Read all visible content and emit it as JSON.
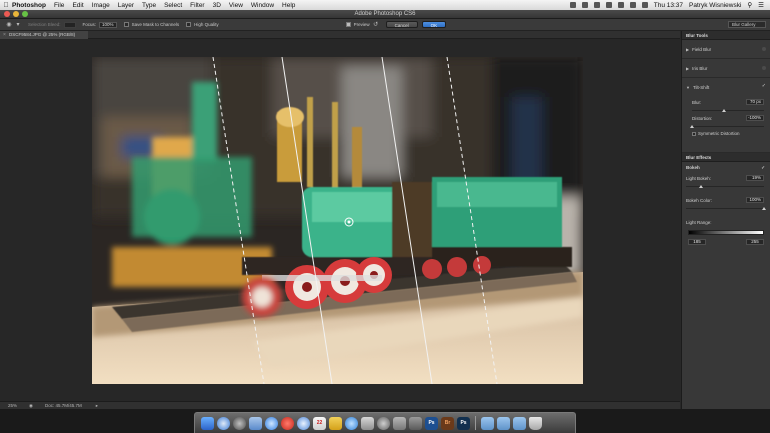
{
  "menubar": {
    "app": "Photoshop",
    "items": [
      "File",
      "Edit",
      "Image",
      "Layer",
      "Type",
      "Select",
      "Filter",
      "3D",
      "View",
      "Window",
      "Help"
    ],
    "clock": "Thu 13:37",
    "user": "Patryk Wisniewski"
  },
  "window": {
    "title": "Adobe Photoshop CS6"
  },
  "options": {
    "selection_bleed": "Selection Bleed:",
    "focus_label": "Focus:",
    "focus_value": "100%",
    "save_mask": "Save Mask to Channels",
    "high_quality": "High Quality",
    "preview": "Preview",
    "cancel": "Cancel",
    "ok": "OK",
    "workspace": "Blur Gallery"
  },
  "document": {
    "tab": "DSCF9584.JPG @ 25% (RGB/8)"
  },
  "status": {
    "zoom": "25%",
    "doc": "Doc: 45.7M/45.7M"
  },
  "panel": {
    "header": "Blur Tools",
    "field_blur": "Field Blur",
    "iris_blur": "Iris Blur",
    "tilt_shift": "Tilt-Shift",
    "blur_label": "Blur:",
    "blur_value": "70 px",
    "distortion_label": "Distortion:",
    "distortion_value": "-100%",
    "symmetric": "Symmetric Distortion",
    "effects_header": "Blur Effects",
    "bokeh": "Bokeh",
    "light_bokeh_label": "Light Bokeh:",
    "light_bokeh_value": "19%",
    "bokeh_color_label": "Bokeh Color:",
    "bokeh_color_value": "100%",
    "light_range_label": "Light Range:",
    "range_low": "185",
    "range_high": "255"
  },
  "sliders": {
    "blur": 0.45,
    "distortion": 0.0,
    "light_bokeh": 0.19,
    "bokeh_color": 1.0
  },
  "dock": {
    "apps": [
      "finder-icon",
      "safari-icon",
      "launchpad-icon",
      "mail-icon",
      "app-store-icon",
      "calendar-icon",
      "itunes-icon",
      "preview-icon",
      "system-preferences-icon",
      "photoshop-icon",
      "bridge-icon",
      "photoshop-icon",
      "folder-icon",
      "trash-icon"
    ],
    "ps_label": "Ps",
    "br_label": "Br"
  }
}
